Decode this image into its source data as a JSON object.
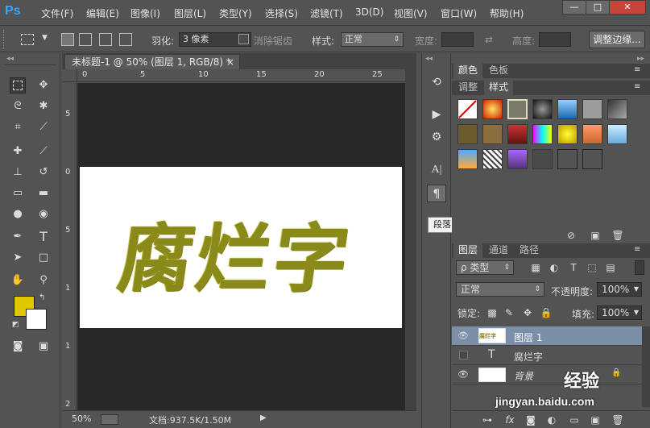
{
  "app": {
    "logo": "Ps"
  },
  "menu": [
    "文件(F)",
    "编辑(E)",
    "图像(I)",
    "图层(L)",
    "类型(Y)",
    "选择(S)",
    "滤镜(T)",
    "3D(D)",
    "视图(V)",
    "窗口(W)",
    "帮助(H)"
  ],
  "window_buttons": [
    "—",
    "□",
    "✕"
  ],
  "options": {
    "feather_label": "羽化:",
    "feather_value": "3 像素",
    "antialias_label": "消除锯齿",
    "style_label": "样式:",
    "style_value": "正常",
    "width_label": "宽度:",
    "height_label": "高度:",
    "refine_button": "调整边缘..."
  },
  "document": {
    "tab_title": "未标题-1 @ 50% (图层 1, RGB/8) *",
    "tab_close": "×",
    "canvas_text": "腐烂字",
    "ruler_top": [
      "0",
      "5",
      "10",
      "15",
      "20",
      "25"
    ],
    "ruler_left": [
      "5",
      "0",
      "5",
      "1",
      "1",
      "2"
    ]
  },
  "status": {
    "zoom": "50%",
    "doc_info": "文档:937.5K/1.50M"
  },
  "tooltip": "段落",
  "colors": {
    "foreground": "#e1c800",
    "background": "#ffffff"
  },
  "panels": {
    "top_tabs": [
      "颜色",
      "色板"
    ],
    "mid_tabs": [
      "调整",
      "样式"
    ],
    "layers_tabs": [
      "图层",
      "通道",
      "路径"
    ],
    "filter_kind": "ρ 类型",
    "blend_mode": "正常",
    "opacity_label": "不透明度:",
    "opacity_value": "100%",
    "lock_label": "锁定:",
    "fill_label": "填充:",
    "fill_value": "100%",
    "layers": [
      {
        "name": "图层 1",
        "visible": true,
        "type": "pixel",
        "selected": true
      },
      {
        "name": "腐烂字",
        "visible": false,
        "type": "text",
        "selected": false
      },
      {
        "name": "背景",
        "visible": true,
        "type": "background",
        "selected": false
      }
    ]
  },
  "watermark": {
    "brand": "经验",
    "site": "jingyan.baidu.com"
  }
}
